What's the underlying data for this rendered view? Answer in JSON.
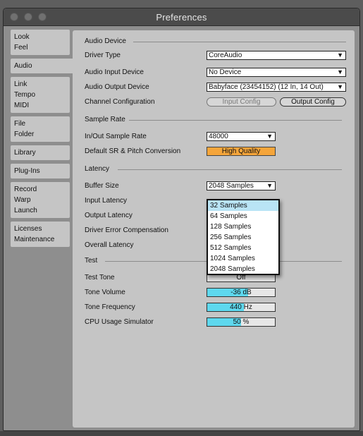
{
  "window": {
    "title": "Preferences"
  },
  "sidebar": {
    "items": [
      {
        "lines": [
          "Look",
          "Feel"
        ]
      },
      {
        "lines": [
          "Audio"
        ]
      },
      {
        "lines": [
          "Link",
          "Tempo",
          "MIDI"
        ]
      },
      {
        "lines": [
          "File",
          "Folder"
        ]
      },
      {
        "lines": [
          "Library"
        ]
      },
      {
        "lines": [
          "Plug-Ins"
        ]
      },
      {
        "lines": [
          "Record",
          "Warp",
          "Launch"
        ]
      },
      {
        "lines": [
          "Licenses",
          "Maintenance"
        ]
      }
    ],
    "active": "Audio"
  },
  "audio_device": {
    "heading": "Audio Device",
    "driver_type": {
      "label": "Driver Type",
      "value": "CoreAudio"
    },
    "input_device": {
      "label": "Audio Input Device",
      "value": "No Device"
    },
    "output_device": {
      "label": "Audio Output Device",
      "value": "Babyface (23454152) (12 In, 14 Out)"
    },
    "channel_config": {
      "label": "Channel Configuration",
      "input_button": "Input Config",
      "output_button": "Output Config"
    }
  },
  "sample_rate": {
    "heading": "Sample Rate",
    "in_out": {
      "label": "In/Out Sample Rate",
      "value": "48000"
    },
    "conversion": {
      "label": "Default SR & Pitch Conversion",
      "value": "High Quality"
    }
  },
  "latency": {
    "heading": "Latency",
    "buffer_size": {
      "label": "Buffer Size",
      "value": "2048 Samples"
    },
    "input_latency_label": "Input Latency",
    "output_latency_label": "Output Latency",
    "driver_error_label": "Driver Error Compensation",
    "overall_latency_label": "Overall Latency",
    "dropdown_options": [
      "32 Samples",
      "64 Samples",
      "128 Samples",
      "256 Samples",
      "512 Samples",
      "1024 Samples",
      "2048 Samples"
    ],
    "highlighted_option": "32 Samples"
  },
  "test": {
    "heading": "Test",
    "tone": {
      "label": "Test Tone",
      "value": "Off"
    },
    "volume": {
      "label": "Tone Volume",
      "value": "-36 dB",
      "fill_fraction": 0.6
    },
    "frequency": {
      "label": "Tone Frequency",
      "value": "440 Hz",
      "fill_fraction": 0.54
    },
    "cpu": {
      "label": "CPU Usage Simulator",
      "value": "50 %",
      "fill_fraction": 0.5
    }
  },
  "colors": {
    "accent_orange": "#f5a53a",
    "accent_cyan": "#5ed8ee",
    "panel": "#c5c5c5"
  }
}
